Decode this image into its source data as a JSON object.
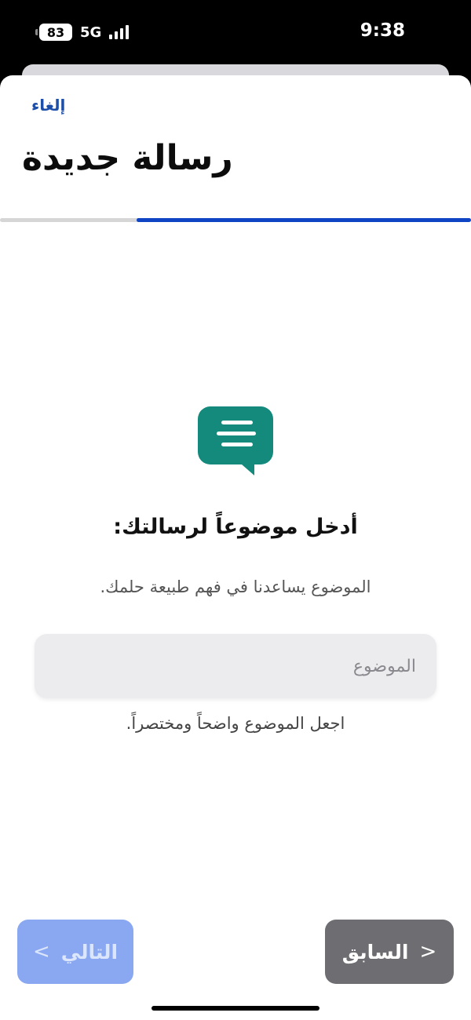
{
  "status_bar": {
    "battery": "83",
    "network": "5G",
    "time": "9:38"
  },
  "header": {
    "cancel_label": "إلغاء",
    "title": "رسالة جديدة"
  },
  "progress": {
    "fraction": 0.71
  },
  "content": {
    "icon": "message-bubble-icon",
    "prompt": "أدخل موضوعاً لرسالتك:",
    "helper": "الموضوع يساعدنا في فهم طبيعة حلمك.",
    "subject_field": {
      "placeholder": "الموضوع",
      "value": ""
    },
    "hint": "اجعل الموضوع واضحاً ومختصراً."
  },
  "footer": {
    "next_label": "التالي",
    "prev_label": "السابق"
  },
  "colors": {
    "accent": "#0f44c5",
    "icon": "#138a7c",
    "next_button": "#8aa8f2",
    "prev_button": "#6e6e72"
  }
}
